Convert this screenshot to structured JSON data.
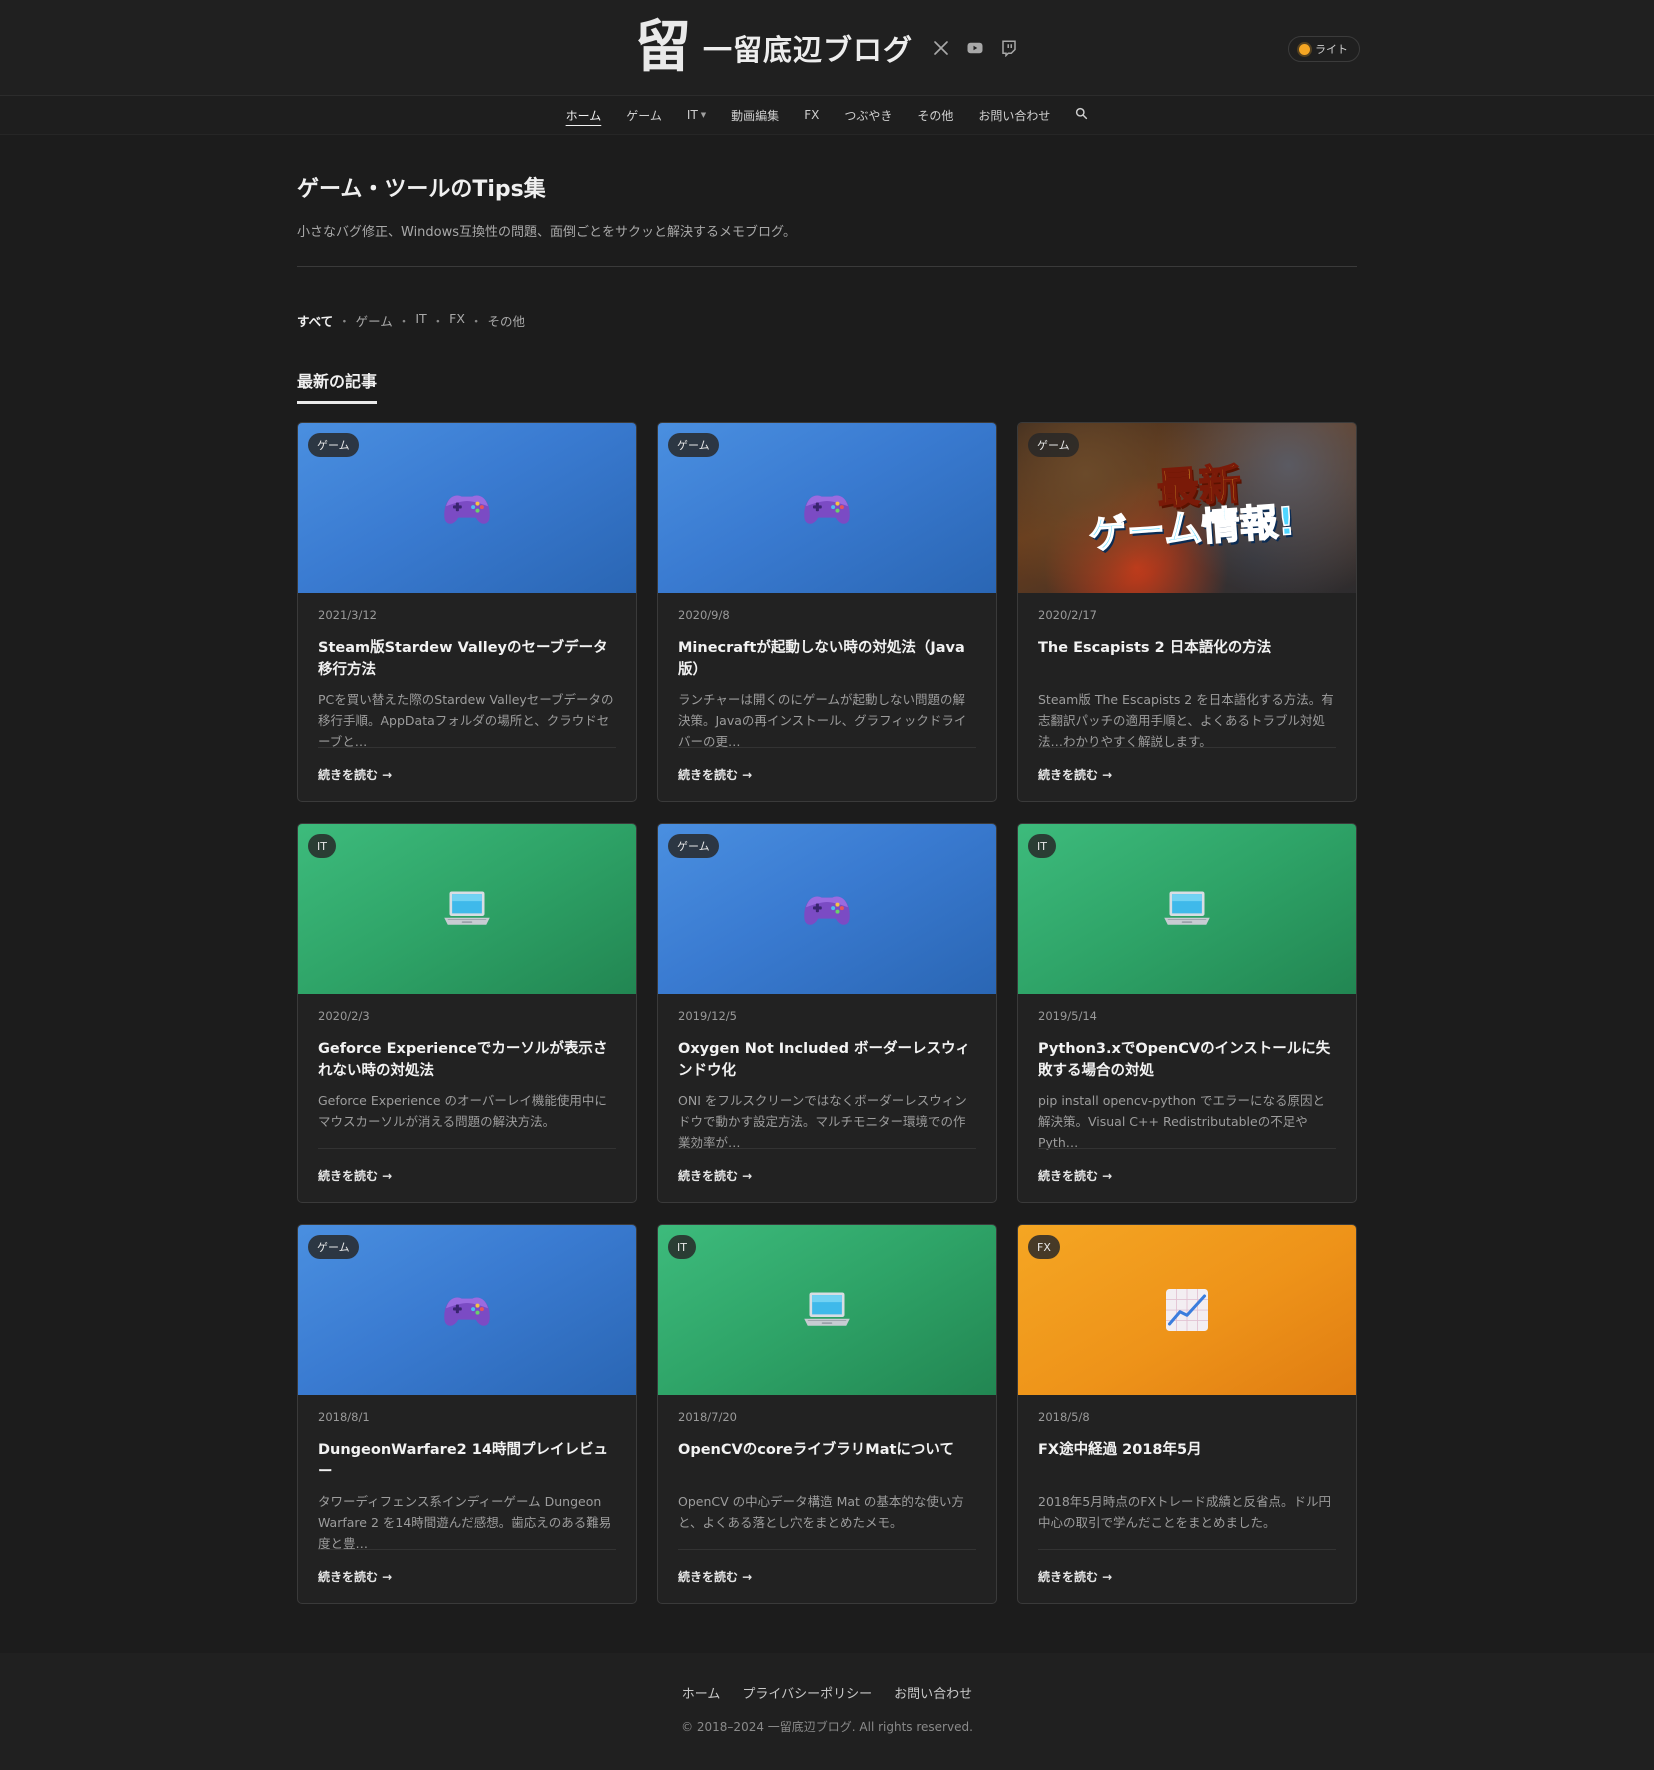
{
  "header": {
    "logo_mark": "留",
    "site_title": "一留底辺ブログ",
    "social_icons": [
      "x-icon",
      "youtube-icon",
      "twitch-icon"
    ],
    "theme_toggle_label": "ライト"
  },
  "nav": {
    "items": [
      {
        "label": "ホーム",
        "active": true
      },
      {
        "label": "ゲーム"
      },
      {
        "label": "IT",
        "has_dropdown": true
      },
      {
        "label": "動画編集"
      },
      {
        "label": "FX"
      },
      {
        "label": "つぶやき"
      },
      {
        "label": "その他"
      },
      {
        "label": "お問い合わせ"
      }
    ],
    "search_icon": "search-icon"
  },
  "page": {
    "title": "ゲーム・ツールのTips集",
    "description": "小さなバグ修正、Windows互換性の問題、面倒ごとをサクッと解決するメモブログ。"
  },
  "category_filter": [
    "すべて",
    "ゲーム",
    "IT",
    "FX",
    "その他"
  ],
  "section_title": "最新の記事",
  "read_more_label": "続きを読む →",
  "posts": [
    {
      "category": "ゲーム",
      "type": "game",
      "date": "2021/3/12",
      "title": "Steam版Stardew Valleyのセーブデータ移行方法",
      "excerpt": "PCを買い替えた際のStardew Valleyセーブデータの移行手順。AppDataフォルダの場所と、クラウドセーブと…"
    },
    {
      "category": "ゲーム",
      "type": "game",
      "date": "2020/9/8",
      "title": "Minecraftが起動しない時の対処法（Java版）",
      "excerpt": "ランチャーは開くのにゲームが起動しない問題の解決策。Javaの再インストール、グラフィックドライバーの更…"
    },
    {
      "category": "ゲーム",
      "type": "photo",
      "banner_line1": "最新",
      "banner_line2": "ゲーム情報!",
      "date": "2020/2/17",
      "title": "The Escapists 2 日本語化の方法",
      "excerpt": "Steam版 The Escapists 2 を日本語化する方法。有志翻訳パッチの適用手順と、よくあるトラブル対処法…わかりやすく解説します。"
    },
    {
      "category": "IT",
      "type": "it",
      "date": "2020/2/3",
      "title": "Geforce Experienceでカーソルが表示されない時の対処法",
      "excerpt": "Geforce Experience のオーバーレイ機能使用中にマウスカーソルが消える問題の解決方法。"
    },
    {
      "category": "ゲーム",
      "type": "game",
      "date": "2019/12/5",
      "title": "Oxygen Not Included ボーダーレスウィンドウ化",
      "excerpt": "ONI をフルスクリーンではなくボーダーレスウィンドウで動かす設定方法。マルチモニター環境での作業効率が…"
    },
    {
      "category": "IT",
      "type": "it",
      "date": "2019/5/14",
      "title": "Python3.xでOpenCVのインストールに失敗する場合の対処",
      "excerpt": "pip install opencv-python でエラーになる原因と解決策。Visual C++ Redistributableの不足やPyth…"
    },
    {
      "category": "ゲーム",
      "type": "game",
      "date": "2018/8/1",
      "title": "DungeonWarfare2 14時間プレイレビュー",
      "excerpt": "タワーディフェンス系インディーゲーム Dungeon Warfare 2 を14時間遊んだ感想。歯応えのある難易度と豊…"
    },
    {
      "category": "IT",
      "type": "it",
      "date": "2018/7/20",
      "title": "OpenCVのcoreライブラリMatについて",
      "excerpt": "OpenCV の中心データ構造 Mat の基本的な使い方と、よくある落とし穴をまとめたメモ。"
    },
    {
      "category": "FX",
      "type": "fx",
      "date": "2018/5/8",
      "title": "FX途中経過 2018年5月",
      "excerpt": "2018年5月時点のFXトレード成績と反省点。ドル円中心の取引で学んだことをまとめました。"
    }
  ],
  "footer": {
    "links": [
      "ホーム",
      "プライバシーポリシー",
      "お問い合わせ"
    ],
    "copyright": "© 2018–2024 一留底辺ブログ. All rights reserved."
  }
}
